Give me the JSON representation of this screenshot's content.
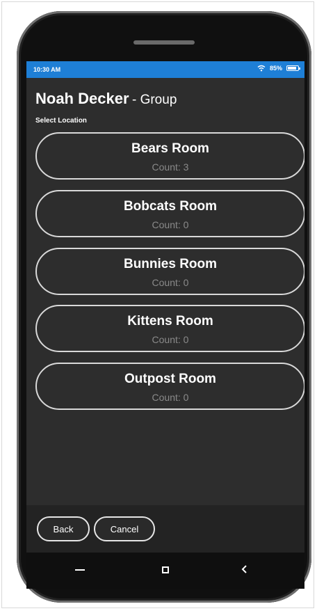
{
  "status_bar": {
    "time": "10:30 AM",
    "battery": "85%"
  },
  "header": {
    "name": "Noah Decker",
    "suffix": "- Group",
    "subtitle": "Select Location"
  },
  "rooms": [
    {
      "name": "Bears Room",
      "count": "Count: 3"
    },
    {
      "name": "Bobcats Room",
      "count": "Count: 0"
    },
    {
      "name": "Bunnies Room",
      "count": "Count: 0"
    },
    {
      "name": "Kittens Room",
      "count": "Count: 0"
    },
    {
      "name": "Outpost Room",
      "count": "Count: 0"
    }
  ],
  "footer": {
    "back_label": "Back",
    "cancel_label": "Cancel"
  },
  "colors": {
    "status_bar": "#1e7fd6",
    "screen_bg": "#2d2d2d",
    "count_text": "#8a8a8a"
  },
  "icons": [
    "wifi-icon",
    "battery-icon",
    "nav-minus-icon",
    "nav-square-icon",
    "nav-back-icon"
  ]
}
